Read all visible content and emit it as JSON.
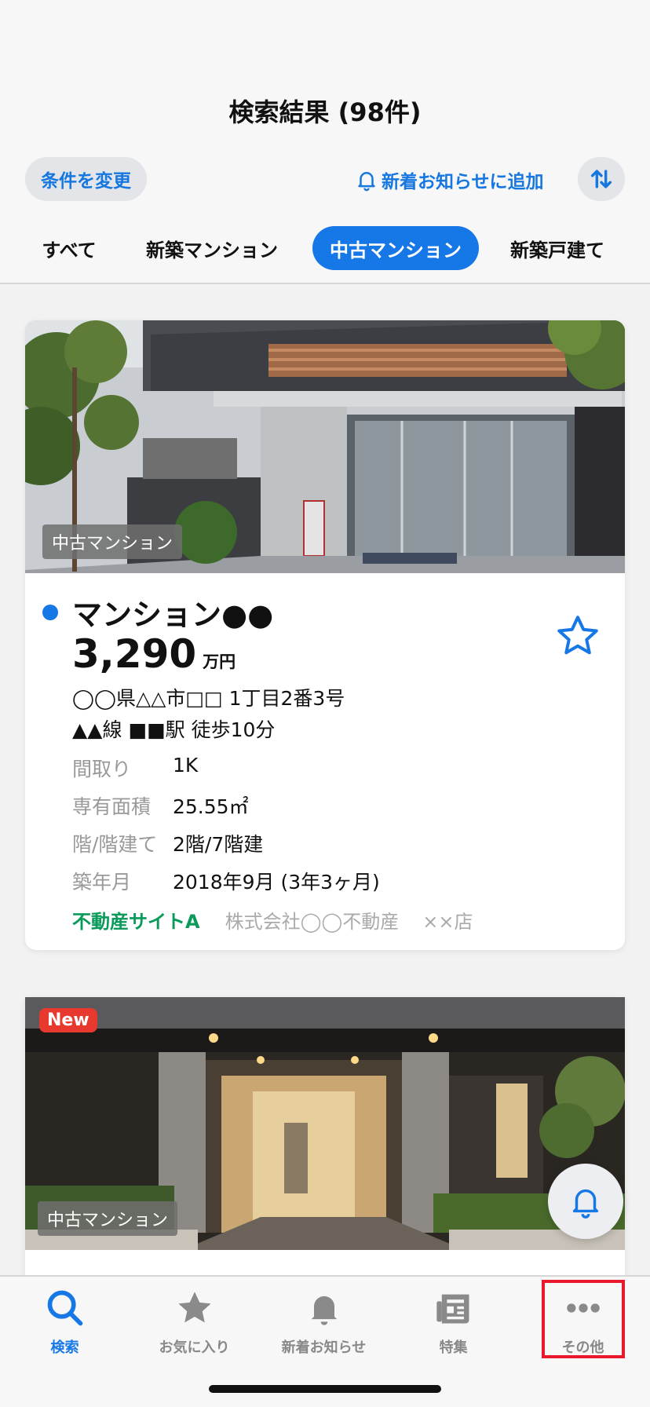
{
  "header": {
    "title": "検索結果 (98件)",
    "change_conditions": "条件を変更",
    "add_notification": "新着お知らせに追加"
  },
  "tabs": [
    {
      "label": "すべて",
      "active": false
    },
    {
      "label": "新築マンション",
      "active": false
    },
    {
      "label": "中古マンション",
      "active": true
    },
    {
      "label": "新築戸建て",
      "active": false
    }
  ],
  "listings": [
    {
      "type_badge": "中古マンション",
      "name": "マンション●●",
      "price": "3,290",
      "price_unit": "万円",
      "address": "◯◯県△△市□□ 1丁目2番3号",
      "station": "▲▲線 ■■駅 徒歩10分",
      "specs": [
        {
          "key": "間取り",
          "value": "1K"
        },
        {
          "key": "専有面積",
          "value": "25.55㎡"
        },
        {
          "key": "階/階建て",
          "value": "2階/7階建"
        },
        {
          "key": "築年月",
          "value": "2018年9月 (3年3ヶ月)"
        }
      ],
      "source_site": "不動産サイトA",
      "company": "株式会社◯◯不動産",
      "branch": "××店"
    },
    {
      "new_badge": "New",
      "type_badge": "中古マンション"
    }
  ],
  "tabbar": [
    {
      "label": "検索",
      "icon": "search-icon",
      "active": true
    },
    {
      "label": "お気に入り",
      "icon": "star-icon",
      "active": false
    },
    {
      "label": "新着お知らせ",
      "icon": "bell-icon",
      "active": false
    },
    {
      "label": "特集",
      "icon": "newspaper-icon",
      "active": false
    },
    {
      "label": "その他",
      "icon": "more-icon",
      "active": false
    }
  ],
  "colors": {
    "accent": "#1677e6",
    "source_green": "#0a9a5a",
    "new_red": "#e8392f",
    "highlight_red": "#e8192c"
  }
}
